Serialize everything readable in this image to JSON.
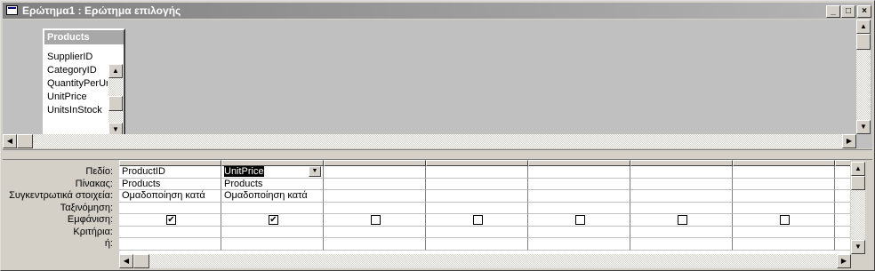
{
  "window": {
    "title": "Ερώτημα1 : Ερώτημα επιλογής",
    "minimize_label": "_",
    "restore_label": "□",
    "close_label": "×"
  },
  "field_list": {
    "title": "Products",
    "fields": [
      "SupplierID",
      "CategoryID",
      "QuantityPerUnit",
      "UnitPrice",
      "UnitsInStock"
    ]
  },
  "scroll_glyphs": {
    "up": "▲",
    "down": "▼",
    "left": "◀",
    "right": "▶"
  },
  "grid": {
    "row_labels": [
      "Πεδίο:",
      "Πίνακας:",
      "Συγκεντρωτικά στοιχεία:",
      "Ταξινόμηση:",
      "Εμφάνιση:",
      "Κριτήρια:",
      "ή:"
    ],
    "columns": [
      {
        "field": "ProductID",
        "table": "Products",
        "total": "Ομαδοποίηση κατά",
        "show": true
      },
      {
        "field": "UnitPrice",
        "table": "Products",
        "total": "Ομαδοποίηση κατά",
        "show": true,
        "selected": true
      },
      {
        "field": "",
        "table": "",
        "total": "",
        "show": false
      },
      {
        "field": "",
        "table": "",
        "total": "",
        "show": false
      },
      {
        "field": "",
        "table": "",
        "total": "",
        "show": false
      },
      {
        "field": "",
        "table": "",
        "total": "",
        "show": false
      },
      {
        "field": "",
        "table": "",
        "total": "",
        "show": false
      },
      {
        "field": "",
        "table": "",
        "total": "",
        "show": false
      }
    ],
    "checkmark": "✔"
  }
}
